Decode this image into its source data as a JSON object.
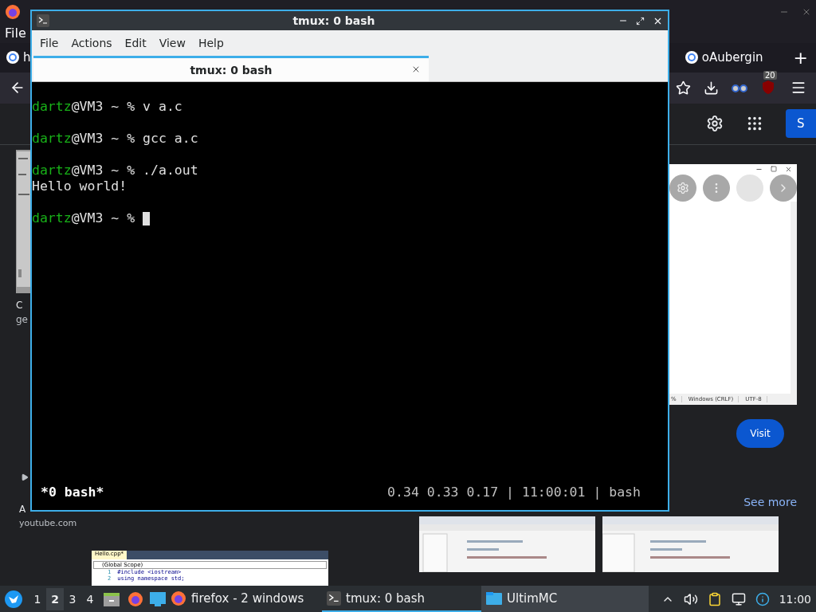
{
  "browser": {
    "menu": [
      "File"
    ],
    "tabs": [
      {
        "label": "h",
        "selected": false
      },
      {
        "label": "oAubergin",
        "selected": false
      }
    ],
    "new_tab": "+",
    "extension_badge": "20",
    "account_button": "S",
    "left_result": {
      "title": "C",
      "subtitle": "ge"
    },
    "video_result": {
      "title": "A",
      "source": "youtube.com"
    },
    "code_thumbnail": {
      "tab": "Hello.cpp*",
      "scope": "(Global Scope)",
      "lines": [
        {
          "number": "1",
          "code": "#include <iostream>"
        },
        {
          "number": "2",
          "code": "using namespace std;"
        }
      ]
    },
    "image_viewer": {
      "status": [
        "%",
        "Windows (CRLF)",
        "UTF-8"
      ]
    },
    "visit_button": "Visit",
    "see_more": "See more"
  },
  "terminal": {
    "title": "tmux: 0 bash",
    "menu": [
      "File",
      "Actions",
      "Edit",
      "View",
      "Help"
    ],
    "tab": {
      "label": "tmux: 0 bash",
      "selected": true
    },
    "lines": [
      {
        "kind": "blank"
      },
      {
        "kind": "prompt",
        "user": "dartz",
        "host": "@VM3 ~ % ",
        "command": "v a.c"
      },
      {
        "kind": "blank"
      },
      {
        "kind": "prompt",
        "user": "dartz",
        "host": "@VM3 ~ % ",
        "command": "gcc a.c"
      },
      {
        "kind": "blank"
      },
      {
        "kind": "prompt",
        "user": "dartz",
        "host": "@VM3 ~ % ",
        "command": "./a.out"
      },
      {
        "kind": "output",
        "text": "Hello world!"
      },
      {
        "kind": "blank"
      },
      {
        "kind": "prompt",
        "user": "dartz",
        "host": "@VM3 ~ % ",
        "cursor": true
      }
    ],
    "status_left": "*0 bash*",
    "status_right": "0.34 0.33 0.17 | 11:00:01 | bash"
  },
  "taskbar": {
    "workspaces": [
      {
        "label": "1",
        "selected": false
      },
      {
        "label": "2",
        "selected": true
      },
      {
        "label": "3",
        "selected": false
      },
      {
        "label": "4",
        "selected": false
      }
    ],
    "tasks": [
      {
        "kind": "firefox",
        "label": "firefox - 2 windows",
        "selected": false,
        "hovered": false
      },
      {
        "kind": "terminal",
        "label": "tmux: 0 bash",
        "selected": true,
        "hovered": false
      },
      {
        "kind": "folder",
        "label": "UltimMC",
        "selected": false,
        "hovered": true
      }
    ],
    "clock": "11:00"
  }
}
